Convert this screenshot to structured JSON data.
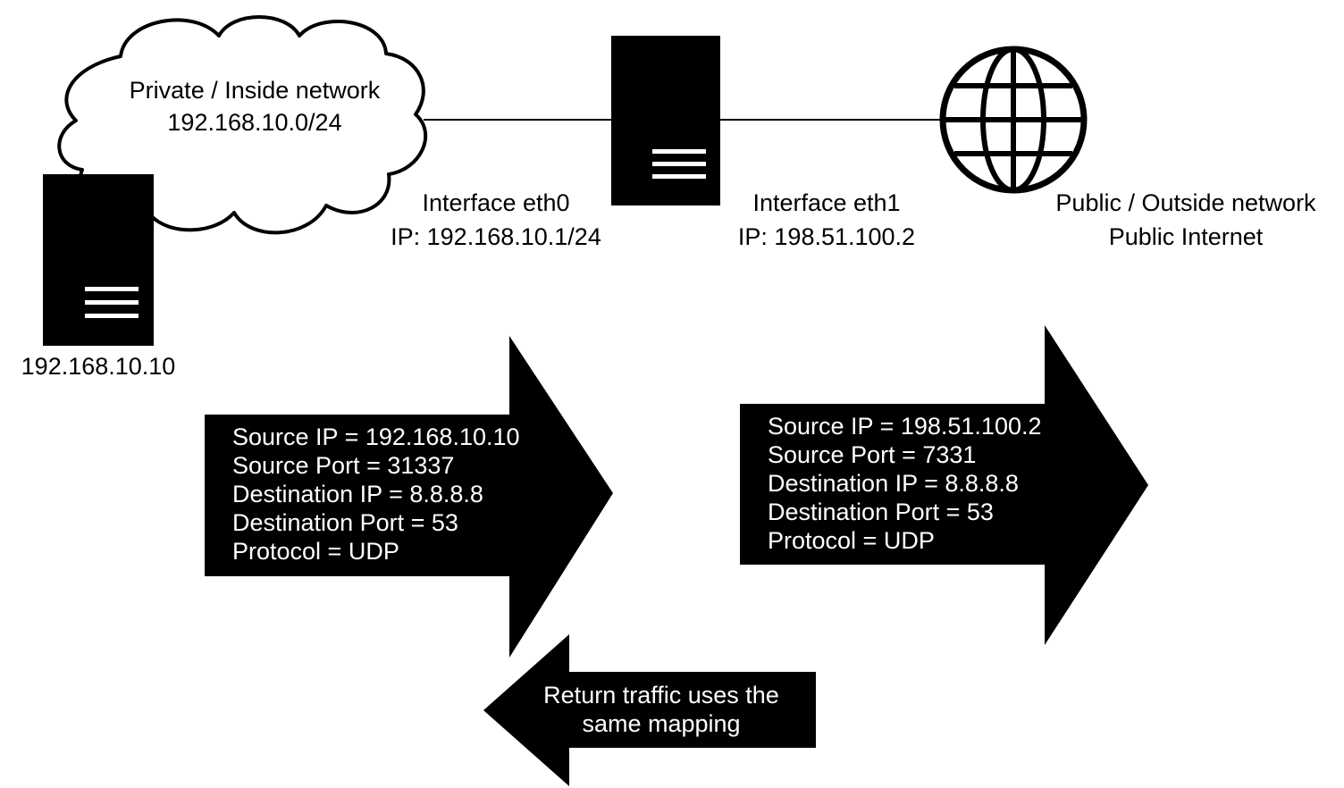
{
  "cloud": {
    "title": "Private / Inside network",
    "subnet": "192.168.10.0/24"
  },
  "host": {
    "ip": "192.168.10.10"
  },
  "router": {
    "eth0": {
      "name": "Interface eth0",
      "ip": "IP: 192.168.10.1/24"
    },
    "eth1": {
      "name": "Interface eth1",
      "ip": "IP: 198.51.100.2"
    }
  },
  "internet": {
    "title": "Public / Outside network",
    "subtitle": "Public Internet"
  },
  "packet_inside": {
    "lines": [
      "Source IP = 192.168.10.10",
      "Source Port = 31337",
      "Destination IP = 8.8.8.8",
      "Destination Port = 53",
      "Protocol = UDP"
    ]
  },
  "packet_outside": {
    "lines": [
      "Source IP = 198.51.100.2",
      "Source Port = 7331",
      "Destination IP = 8.8.8.8",
      "Destination Port = 53",
      "Protocol = UDP"
    ]
  },
  "return_arrow": {
    "line1": "Return traffic uses the",
    "line2": "same mapping"
  },
  "colors": {
    "fill": "#000000",
    "background": "#ffffff",
    "text_on_dark": "#ffffff"
  }
}
